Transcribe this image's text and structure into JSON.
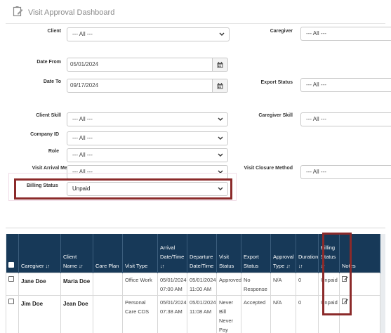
{
  "page": {
    "title": "Visit Approval Dashboard"
  },
  "filters": {
    "client": {
      "label": "Client",
      "value": "--- All ---"
    },
    "caregiver": {
      "label": "Caregiver",
      "value": "--- All ---"
    },
    "date_from": {
      "label": "Date From",
      "value": "05/01/2024"
    },
    "date_to": {
      "label": "Date To",
      "value": "09/17/2024"
    },
    "export_status": {
      "label": "Export Status",
      "value": "--- All ---"
    },
    "client_skill": {
      "label": "Client Skill",
      "value": "--- All ---"
    },
    "caregiver_skill": {
      "label": "Caregiver Skill",
      "value": "--- All ---"
    },
    "company_id": {
      "label": "Company ID",
      "value": "--- All ---"
    },
    "role": {
      "label": "Role",
      "value": "--- All ---"
    },
    "visit_arrival_method": {
      "label": "Visit Arrival Method",
      "value": "--- All ---"
    },
    "visit_closure_method": {
      "label": "Visit Closure Method",
      "value": "--- All ---"
    },
    "billing_status": {
      "label": "Billing Status",
      "value": "Unpaid"
    }
  },
  "table": {
    "columns": {
      "caregiver": "Caregiver",
      "client_name": "Client\nName",
      "care_plan": "Care Plan",
      "visit_type": "Visit Type",
      "arrival": "Arrival\nDate/Time",
      "departure": "Departure\nDate/Time",
      "visit_status": "Visit\nStatus",
      "export_status": "Export\nStatus",
      "approval_type": "Approval\nType",
      "duration": "Duration",
      "billing_status": "Billing\nStatus",
      "notes": "Notes"
    },
    "sort_glyph": "↓↑",
    "rows": [
      {
        "caregiver": "Jane Doe",
        "client": "Maria Doe",
        "care_plan": "",
        "visit_type": "Office Work",
        "arrival": "05/01/2024\n07:00 AM",
        "departure": "05/01/2024\n11:00 AM",
        "visit_status": "Approved",
        "export_status": "No\nResponse",
        "approval_type": "N/A",
        "duration": "0",
        "billing_status": "Unpaid"
      },
      {
        "caregiver": "Jim Doe",
        "client": "Jean Doe",
        "care_plan": "",
        "visit_type": "Personal\nCare CDS",
        "arrival": "05/01/2024\n07:38 AM",
        "departure": "05/01/2024\n11:08 AM",
        "visit_status": "Never Bill\nNever\nPay",
        "export_status": "Accepted",
        "approval_type": "N/A",
        "duration": "0",
        "billing_status": "Unpaid"
      }
    ]
  }
}
